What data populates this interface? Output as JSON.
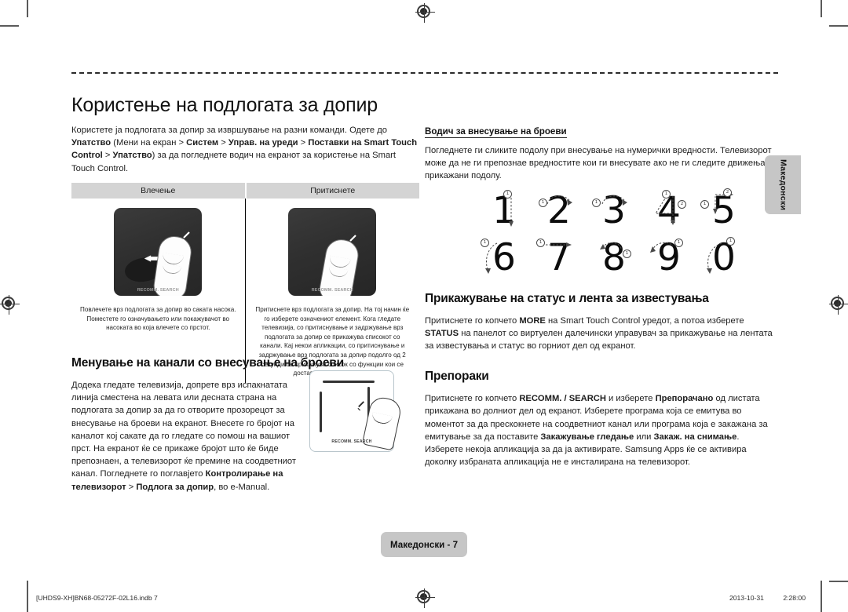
{
  "document": {
    "title": "Користење на подлогата за допир",
    "language_tab": "Македонски",
    "page_label": "Македонски - 7"
  },
  "intro": {
    "text_parts": [
      {
        "t": "Користете ја подлогата за допир за извршување на разни команди. Одете до ",
        "b": false
      },
      {
        "t": "Упатство",
        "b": true
      },
      {
        "t": " (Мени на екран > ",
        "b": false
      },
      {
        "t": "Систем",
        "b": true
      },
      {
        "t": " > ",
        "b": false
      },
      {
        "t": "Управ. на уреди",
        "b": true
      },
      {
        "t": " > ",
        "b": false
      },
      {
        "t": "Поставки на Smart Touch Control",
        "b": true
      },
      {
        "t": " > ",
        "b": false
      },
      {
        "t": "Упатство",
        "b": true
      },
      {
        "t": ") за да погледнете водич на екранот за користење на Smart Touch Control.",
        "b": false
      }
    ]
  },
  "gesture_table": {
    "headers": [
      "Влечење",
      "Притиснете"
    ],
    "pad_label": "RECOMM. SEARCH",
    "cells": [
      {
        "caption": "Повлечете врз подлогата за допир во саката насока. Поместете го означувањето или покажувачот во насоката во која влечете со прстот."
      },
      {
        "caption": "Притиснете врз подлогата за допир. На тој начин ќе го изберете означениот елемент. Кога гледате телевизија, со притиснување и задржување врз подлогата за допир се прикажува списокот со канали. Кај некои апликации, со притиснување и задржување врз подлогата за допир подолго од 2 секунди се прикажува список со функции кои се достапни за апликацијата."
      }
    ]
  },
  "channel_section": {
    "heading": "Менување на канали со внесување на броеви",
    "text_parts": [
      {
        "t": "Додека гледате телевизија, допрете врз испакнатата линија сместена на левата или десната страна на подлогата за допир за да го отворите прозорецот за внесување на броеви на екранот. Внесете го бројот на каналот кој сакате да го гледате со помош на вашиот прст. На екранот ќе се прикаже бројот што ќе биде препознаен, а телевизорот ќе премине на соодветниот канал. Погледнете го поглавјето ",
        "b": false
      },
      {
        "t": "Контролирање на телевизорот",
        "b": true
      },
      {
        "t": " > ",
        "b": false
      },
      {
        "t": "Подлога за допир",
        "b": true
      },
      {
        "t": ", во e-Manual.",
        "b": false
      }
    ],
    "pad_label": "RECOMM. SEARCH"
  },
  "number_guide": {
    "heading": "Водич за внесување на броеви",
    "text_parts": [
      {
        "t": "Погледнете ги сликите подолу при внесување на нумерички вредности. Телевизорот може да не ги препознае вредностите кои ги внесувате ако не ги следите движењата прикажани подолу.",
        "b": false
      }
    ],
    "rows": [
      [
        "1",
        "2",
        "3",
        "4",
        "5"
      ],
      [
        "6",
        "7",
        "8",
        "9",
        "0"
      ]
    ],
    "stroke_counts": {
      "1": [
        "1"
      ],
      "2": [
        "1"
      ],
      "3": [
        "1"
      ],
      "4": [
        "1",
        "2"
      ],
      "5": [
        "1",
        "2"
      ],
      "6": [
        "1"
      ],
      "7": [
        "1"
      ],
      "8": [
        "1"
      ],
      "9": [
        "1"
      ],
      "0": [
        "1"
      ]
    }
  },
  "status_section": {
    "heading": "Прикажување на статус и лента за известувања",
    "text_parts": [
      {
        "t": "Притиснете го копчето ",
        "b": false
      },
      {
        "t": "MORE",
        "b": true
      },
      {
        "t": " на Smart Touch Control уредот, а потоа изберете ",
        "b": false
      },
      {
        "t": "STATUS",
        "b": true
      },
      {
        "t": " на панелот со виртуелен далечински управувач за прикажување на лентата за известувања и статус во горниот дел од екранот.",
        "b": false
      }
    ]
  },
  "recommend_section": {
    "heading": "Препораки",
    "text_parts": [
      {
        "t": "Притиснете го копчето ",
        "b": false
      },
      {
        "t": "RECOMM. / SEARCH",
        "b": true
      },
      {
        "t": " и изберете ",
        "b": false
      },
      {
        "t": "Препорачано",
        "b": true
      },
      {
        "t": " од листата прикажана во долниот дел од екранот. Изберете програма која се емитува во моментот за да прескокнете на соодветниот канал или програма која е закажана за емитување за да поставите ",
        "b": false
      },
      {
        "t": "Закажување гледање",
        "b": true
      },
      {
        "t": " или ",
        "b": false
      },
      {
        "t": "Закаж. на снимање",
        "b": true
      },
      {
        "t": ". Изберете некоја апликација за да ја активирате. Samsung Apps ќе се активира доколку избраната апликација не е инсталирана на телевизорот.",
        "b": false
      }
    ]
  },
  "footer": {
    "file": "[UHDS9-XH]BN68-05272F-02L16.indb   7",
    "date": "2013-10-31",
    "time": "2:28:00"
  }
}
